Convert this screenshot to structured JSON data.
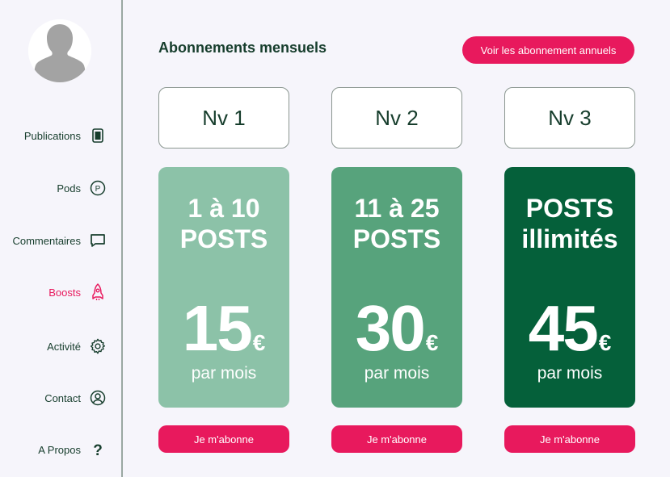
{
  "sidebar": {
    "items": [
      {
        "label": "Publications",
        "icon": "document-icon"
      },
      {
        "label": "Pods",
        "icon": "p-circle-icon"
      },
      {
        "label": "Commentaires",
        "icon": "comment-icon"
      },
      {
        "label": "Boosts",
        "icon": "rocket-icon",
        "active": true
      },
      {
        "label": "Activité",
        "icon": "gear-icon"
      },
      {
        "label": "Contact",
        "icon": "user-circle-icon"
      },
      {
        "label": "A Propos",
        "icon": "question-icon"
      }
    ]
  },
  "main": {
    "title": "Abonnements mensuels",
    "annual_button": "Voir les abonnement annuels",
    "plans": [
      {
        "level": "Nv 1",
        "posts_line1": "1 à 10",
        "posts_line2": "POSTS",
        "price": "15",
        "currency": "€",
        "period": "par mois",
        "cta": "Je m'abonne",
        "color": "#8cc2a8"
      },
      {
        "level": "Nv 2",
        "posts_line1": "11 à 25",
        "posts_line2": "POSTS",
        "price": "30",
        "currency": "€",
        "period": "par mois",
        "cta": "Je m'abonne",
        "color": "#57a37c"
      },
      {
        "level": "Nv 3",
        "posts_line1": "POSTS",
        "posts_line2": "illimités",
        "price": "45",
        "currency": "€",
        "period": "par mois",
        "cta": "Je m'abonne",
        "color": "#05603a"
      }
    ]
  },
  "colors": {
    "accent": "#e8195d",
    "text": "#163d2c",
    "background": "#f6f5fb"
  }
}
